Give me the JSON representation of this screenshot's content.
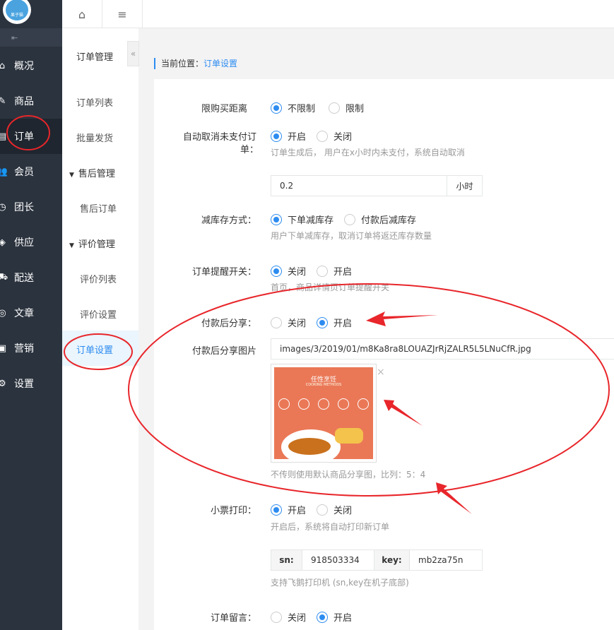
{
  "logo": {
    "text": "果子猫"
  },
  "nav": {
    "items": [
      {
        "label": "概况",
        "icon": "home-icon",
        "glyph": "⌂"
      },
      {
        "label": "商品",
        "icon": "edit-icon",
        "glyph": "✎"
      },
      {
        "label": "订单",
        "icon": "file-icon",
        "glyph": "▤"
      },
      {
        "label": "会员",
        "icon": "users-icon",
        "glyph": "👥"
      },
      {
        "label": "团长",
        "icon": "clock-icon",
        "glyph": "◷"
      },
      {
        "label": "供应",
        "icon": "bag-icon",
        "glyph": "◈"
      },
      {
        "label": "配送",
        "icon": "truck-icon",
        "glyph": "⛟"
      },
      {
        "label": "文章",
        "icon": "compass-icon",
        "glyph": "◎"
      },
      {
        "label": "营销",
        "icon": "gift-icon",
        "glyph": "▣"
      },
      {
        "label": "设置",
        "icon": "gear-icon",
        "glyph": "⚙"
      }
    ]
  },
  "topbar": {
    "home_glyph": "⌂",
    "menu_glyph": "≡",
    "collapse_glyph": "«"
  },
  "sub": {
    "title": "订单管理",
    "items": [
      {
        "label": "订单列表",
        "kind": "item"
      },
      {
        "label": "批量发货",
        "kind": "item"
      },
      {
        "label": "售后管理",
        "kind": "group"
      },
      {
        "label": "售后订单",
        "kind": "item"
      },
      {
        "label": "评价管理",
        "kind": "group"
      },
      {
        "label": "评价列表",
        "kind": "item"
      },
      {
        "label": "评价设置",
        "kind": "item"
      }
    ],
    "active": "订单设置"
  },
  "breadcrumb": {
    "prefix": "当前位置：",
    "current": "订单设置"
  },
  "form": {
    "distance": {
      "label": "限购买距离",
      "opt1": "不限制",
      "opt2": "限制"
    },
    "autocancel": {
      "label1": "自动取消未支付订",
      "label2": "单：",
      "opt1": "开启",
      "opt2": "关闭",
      "hint": "订单生成后， 用户在x小时内未支付，系统自动取消",
      "value": "0.2",
      "unit": "小时"
    },
    "stock": {
      "label": "减库存方式：",
      "opt1": "下单减库存",
      "opt2": "付款后减库存",
      "hint": "用户下单减库存，取消订单将返还库存数量"
    },
    "remind": {
      "label": "订单提醒开关：",
      "opt1": "关闭",
      "opt2": "开启",
      "hint": "首页，商品详情页订单提醒开关"
    },
    "share": {
      "label": "付款后分享：",
      "opt1": "关闭",
      "opt2": "开启"
    },
    "share_img": {
      "label": "付款后分享图片",
      "value": "images/3/2019/01/m8Ka8ra8LOUAZJrRjZALR5L5LNuCfR.jpg",
      "hint": "不传则使用默认商品分享图，比列：5：4",
      "close": "×",
      "img_title": "任性烹饪",
      "img_sub": "COOKING METHODS"
    },
    "printer": {
      "label": "小票打印：",
      "opt1": "开启",
      "opt2": "关闭",
      "hint": "开启后，系统将自动打印新订单",
      "sn_key": "sn:",
      "sn_val": "918503334",
      "key_key": "key:",
      "key_val": "mb2za75n",
      "hint2": "支持飞鹅打印机 (sn,key在机子底部)"
    },
    "note": {
      "label": "订单留言：",
      "opt1": "关闭",
      "opt2": "开启"
    }
  }
}
